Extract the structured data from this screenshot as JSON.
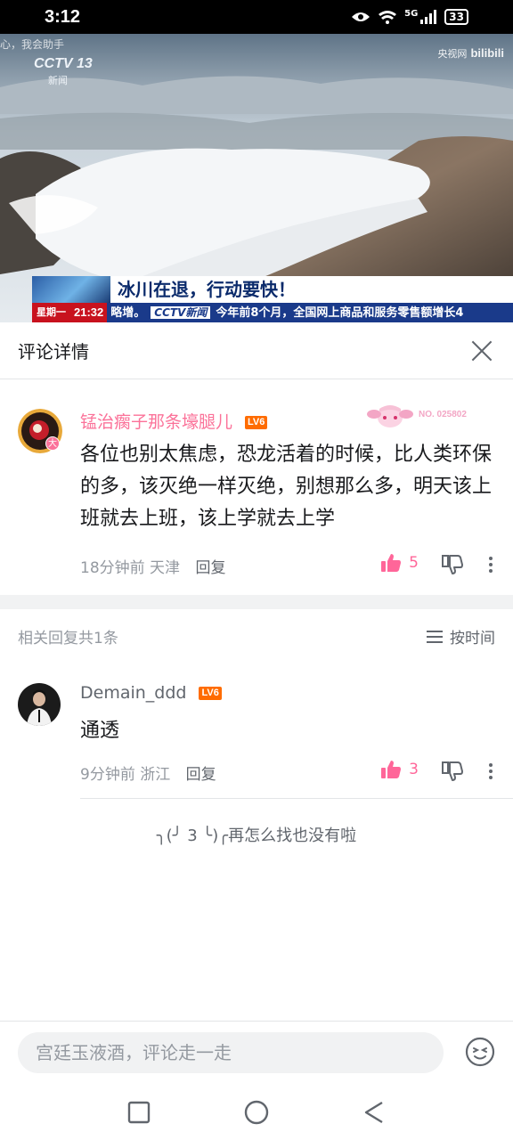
{
  "status_bar": {
    "time": "3:12",
    "network": "5G",
    "battery": "33"
  },
  "video": {
    "faint_text": "心，我会助手",
    "channel_logo": "CCTV 13",
    "channel_sub": "新闻",
    "watermark_text": "央视网",
    "watermark_brand": "bilibili",
    "headline": "冰川在退，行动要快！",
    "ticker_day": "星期一",
    "ticker_time": "21:32",
    "ticker_left": "略增。",
    "ticker_brand": "CCTV新闻",
    "ticker_text": "今年前8个月，全国网上商品和服务零售额增长4"
  },
  "header": {
    "title": "评论详情"
  },
  "main_comment": {
    "username": "锰治瘸子那条壕腿儿",
    "level": "LV6",
    "badge_text": "NO. 025802",
    "avatar_badge": "大",
    "text": "各位也别太焦虑，恐龙活着的时候，比人类环保的多，该灭绝一样灭绝，别想那么多，明天该上班就去上班，该上学就去上学",
    "time": "18分钟前",
    "location": "天津",
    "reply_label": "回复",
    "likes": "5"
  },
  "replies_section": {
    "count_label": "相关回复共1条",
    "sort_label": "按时间"
  },
  "reply": {
    "username": "Demain_ddd",
    "level": "LV6",
    "text": "通透",
    "time": "9分钟前",
    "location": "浙江",
    "reply_label": "回复",
    "likes": "3"
  },
  "end_note": "╮(╯ 3 ╰)╭再怎么找也没有啦",
  "input": {
    "placeholder": "宫廷玉液酒，评论走一走"
  },
  "colors": {
    "accent_pink": "#ff6699",
    "level_orange": "#ff6c00",
    "username_pink": "#fb7299"
  },
  "icons": [
    "eye-icon",
    "wifi-icon",
    "signal-icon",
    "battery-icon",
    "close-icon",
    "thumb-up-icon",
    "thumb-down-icon",
    "more-icon",
    "sort-icon",
    "emoji-icon",
    "nav-recent-icon",
    "nav-home-icon",
    "nav-back-icon"
  ]
}
